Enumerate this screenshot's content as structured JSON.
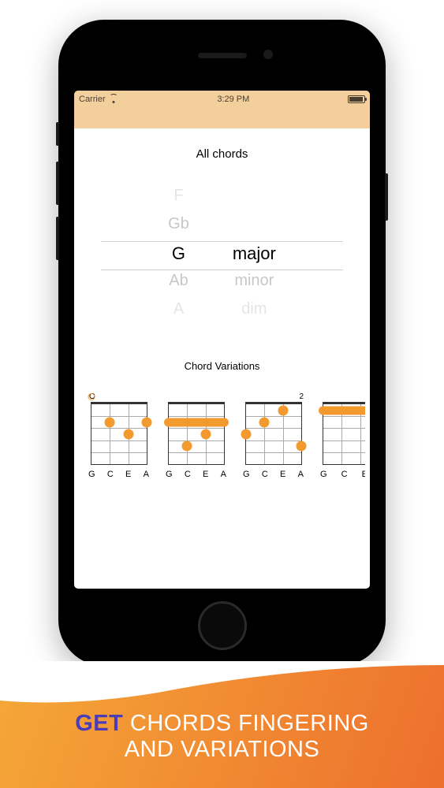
{
  "status": {
    "carrier": "Carrier",
    "time": "3:29 PM"
  },
  "card": {
    "title": "All chords",
    "variations_title": "Chord Variations"
  },
  "picker": {
    "roots": [
      "F",
      "Gb",
      "G",
      "Ab",
      "A"
    ],
    "types": [
      "",
      "",
      "major",
      "minor",
      "dim"
    ],
    "selected_root": "G",
    "selected_type": "major"
  },
  "string_labels": [
    "G",
    "C",
    "E",
    "A"
  ],
  "diagrams": [
    {
      "fret_left": "O",
      "fret_right": ""
    },
    {
      "fret_left": "",
      "fret_right": ""
    },
    {
      "fret_left": "",
      "fret_right": "2"
    },
    {
      "fret_left": "",
      "fret_right": ""
    }
  ],
  "promo": {
    "accent": "GET",
    "line1_rest": " CHORDS FINGERING",
    "line2": "AND VARIATIONS"
  }
}
